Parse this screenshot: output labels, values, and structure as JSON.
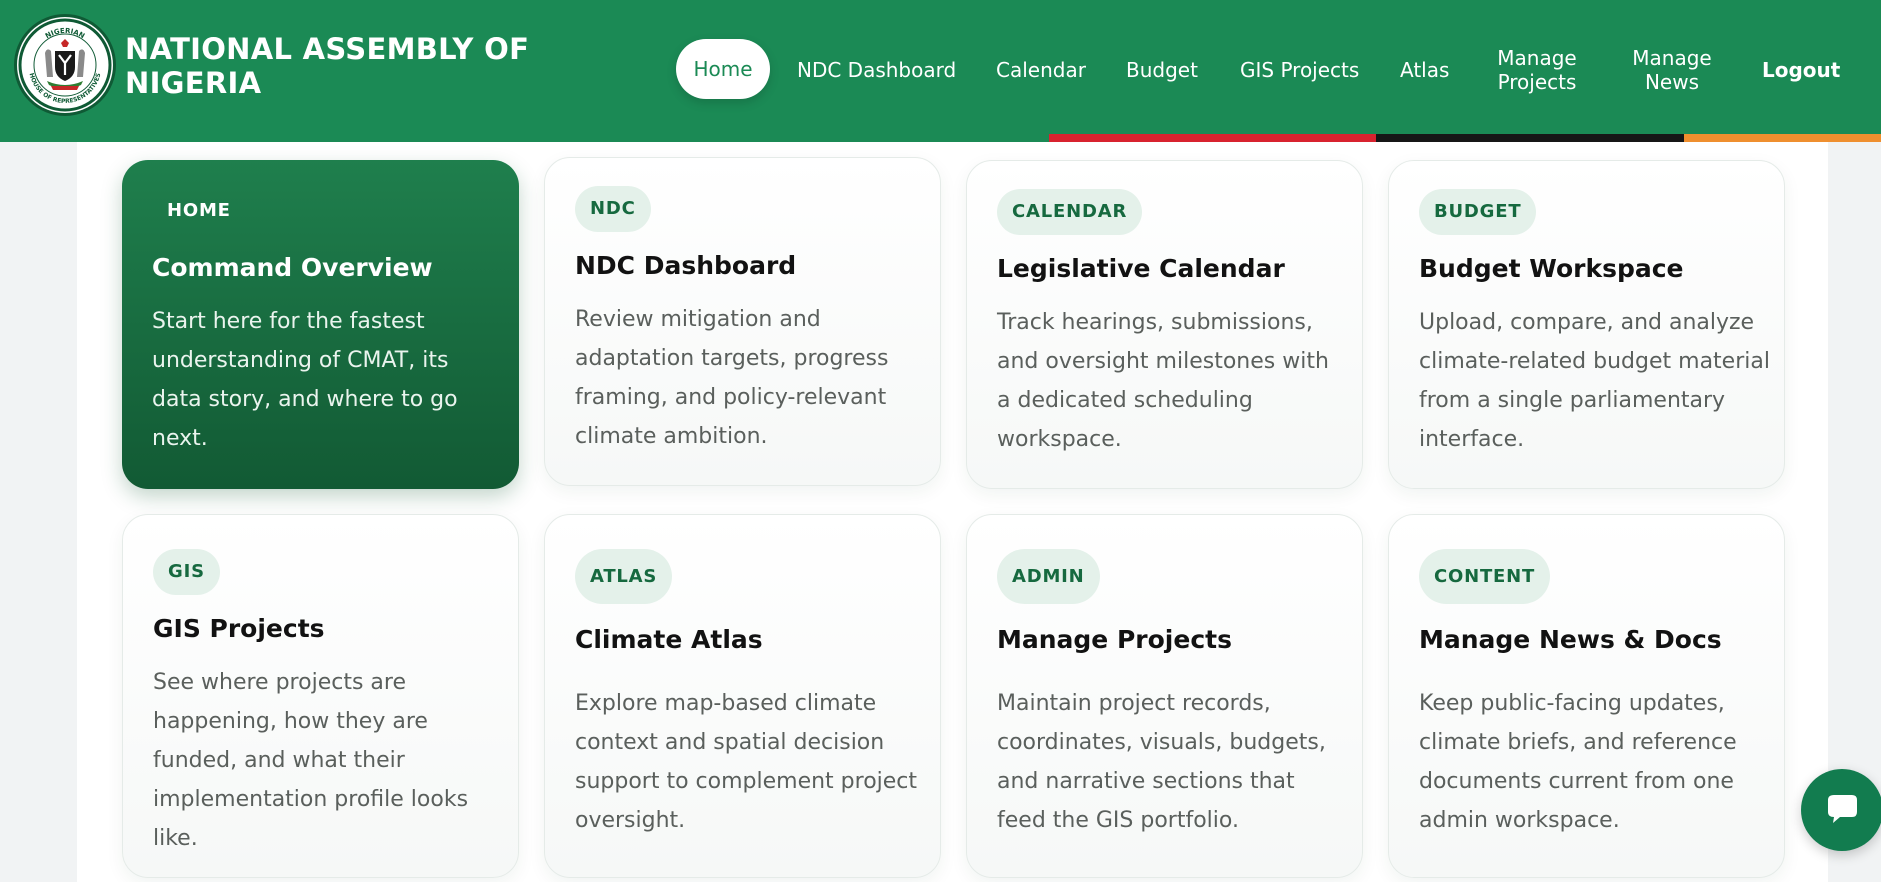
{
  "header": {
    "title": "NATIONAL ASSEMBLY OF NIGERIA",
    "seal_text_top": "NIGERIAN",
    "seal_text_bottom": "HOUSE OF REPRESENTATIVES",
    "colors": {
      "primary": "#1b8a55",
      "stripe_red": "#d8232f",
      "stripe_black": "#161616",
      "stripe_orange": "#ef8f2f"
    }
  },
  "nav": {
    "home": "Home",
    "ndc": "NDC Dashboard",
    "calendar": "Calendar",
    "budget": "Budget",
    "gis": "GIS Projects",
    "atlas": "Atlas",
    "manage_projects_1": "Manage",
    "manage_projects_2": "Projects",
    "manage_news_1": "Manage",
    "manage_news_2": "News",
    "logout": "Logout"
  },
  "cards": [
    {
      "badge": "HOME",
      "title": "Command Overview",
      "desc": "Start here for the fastest understanding of CMAT, its data story, and where to go next."
    },
    {
      "badge": "NDC",
      "title": "NDC Dashboard",
      "desc": "Review mitigation and adaptation targets, progress framing, and policy-relevant climate ambition."
    },
    {
      "badge": "CALENDAR",
      "title": "Legislative Calendar",
      "desc": "Track hearings, submissions, and oversight milestones with a dedicated scheduling workspace."
    },
    {
      "badge": "BUDGET",
      "title": "Budget Workspace",
      "desc": "Upload, compare, and analyze climate-related budget material from a single parliamentary interface."
    },
    {
      "badge": "GIS",
      "title": "GIS Projects",
      "desc": "See where projects are happening, how they are funded, and what their implementation profile looks like."
    },
    {
      "badge": "ATLAS",
      "title": "Climate Atlas",
      "desc": "Explore map-based climate context and spatial decision support to complement project oversight."
    },
    {
      "badge": "ADMIN",
      "title": "Manage Projects",
      "desc": "Maintain project records, coordinates, visuals, budgets, and narrative sections that feed the GIS portfolio."
    },
    {
      "badge": "CONTENT",
      "title": "Manage News & Docs",
      "desc": "Keep public-facing updates, climate briefs, and reference documents current from one admin workspace."
    }
  ],
  "icons": {
    "seal": "coat-of-arms-icon",
    "chat": "chat-bubble-icon"
  }
}
